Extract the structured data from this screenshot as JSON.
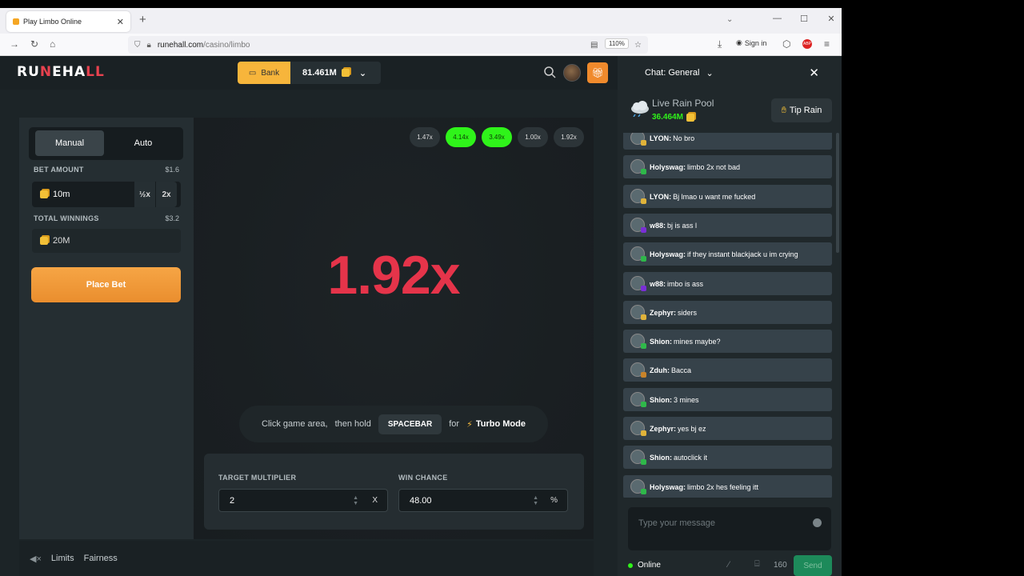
{
  "browser": {
    "tab_title": "Play Limbo Online",
    "url_host": "runehall.com",
    "url_path": "/casino/limbo",
    "zoom": "110%",
    "signin_label": "Sign in"
  },
  "site": {
    "logo": "RUNEHALL",
    "bank_label": "Bank",
    "balance": "81.461M"
  },
  "left": {
    "mode_manual": "Manual",
    "mode_auto": "Auto",
    "bet_amount_label": "BET AMOUNT",
    "bet_amount_usd": "$1.6",
    "bet_amount_value": "10m",
    "half_label": "½x",
    "double_label": "2x",
    "total_winnings_label": "TOTAL WINNINGS",
    "total_winnings_usd": "$3.2",
    "total_winnings_value": "20M",
    "place_bet_label": "Place Bet"
  },
  "game": {
    "history": [
      {
        "value": "1.47x",
        "win": false
      },
      {
        "value": "4.14x",
        "win": true
      },
      {
        "value": "3.49x",
        "win": true
      },
      {
        "value": "1.00x",
        "win": false
      },
      {
        "value": "1.92x",
        "win": false
      }
    ],
    "result": "1.92x",
    "hint_click": "Click game area,",
    "hint_hold": "then hold",
    "hint_key": "SPACEBAR",
    "hint_for": "for",
    "hint_mode": "Turbo Mode",
    "target_label": "TARGET MULTIPLIER",
    "target_value": "2",
    "target_suffix": "X",
    "chance_label": "WIN CHANCE",
    "chance_value": "48.00",
    "chance_suffix": "%"
  },
  "footer": {
    "limits": "Limits",
    "fairness": "Fairness"
  },
  "chat": {
    "title": "Chat: General",
    "rain_label": "Live Rain Pool",
    "rain_amount": "36.464M",
    "tip_rain": "Tip Rain",
    "messages": [
      {
        "user": "LYON:",
        "text": "No bro",
        "rank": "#e0b33a"
      },
      {
        "user": "Holyswag:",
        "text": "limbo 2x not bad",
        "rank": "#2fb84a"
      },
      {
        "user": "LYON:",
        "text": "Bj lmao u want me fucked",
        "rank": "#e0b33a"
      },
      {
        "user": "w88:",
        "text": "bj is ass l",
        "rank": "#7a2fd6"
      },
      {
        "user": "Holyswag:",
        "text": "if they instant blackjack u im crying",
        "rank": "#2fb84a"
      },
      {
        "user": "w88:",
        "text": "imbo is ass",
        "rank": "#7a2fd6"
      },
      {
        "user": "Zephyr:",
        "text": "siders",
        "rank": "#e0b33a"
      },
      {
        "user": "Shion:",
        "text": "mines maybe?",
        "rank": "#2fb84a"
      },
      {
        "user": "Zduh:",
        "text": "Bacca",
        "rank": "#c8832a"
      },
      {
        "user": "Shion:",
        "text": "3 mines",
        "rank": "#2fb84a"
      },
      {
        "user": "Zephyr:",
        "text": "yes bj ez",
        "rank": "#e0b33a"
      },
      {
        "user": "Shion:",
        "text": "autoclick it",
        "rank": "#2fb84a"
      },
      {
        "user": "Holyswag:",
        "text": "limbo 2x hes feeling itt",
        "rank": "#2fb84a"
      }
    ],
    "input_placeholder": "Type your message",
    "online_label": "Online",
    "char_count": "160",
    "send_label": "Send"
  }
}
